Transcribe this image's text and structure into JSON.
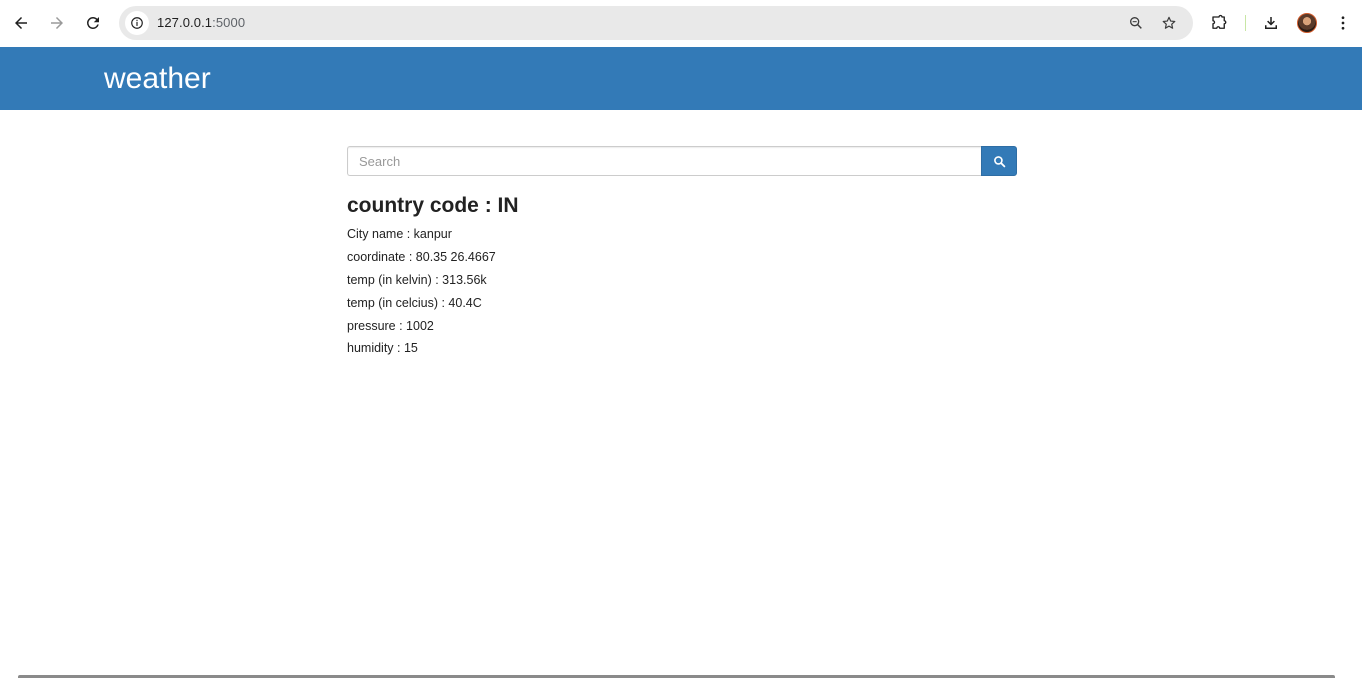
{
  "browser": {
    "url_host": "127.0.0.1",
    "url_port": ":5000",
    "icons": {
      "back": "back-arrow-icon",
      "forward": "forward-arrow-icon",
      "reload": "reload-icon",
      "site_info": "info-icon",
      "zoom": "zoom-icon",
      "bookmark": "star-icon",
      "extensions": "puzzle-icon",
      "downloads": "download-icon",
      "menu": "kebab-menu-icon"
    }
  },
  "navbar": {
    "brand": "weather",
    "background": "#337ab7"
  },
  "search": {
    "placeholder": "Search",
    "value": "",
    "button_icon": "search-icon",
    "button_color": "#337ab7"
  },
  "result": {
    "heading": "country code : IN",
    "city": "City name : kanpur",
    "coordinate": "coordinate : 80.35 26.4667",
    "temp_kelvin": "temp (in kelvin) : 313.56k",
    "temp_celsius": "temp (in celcius) : 40.4C",
    "pressure": "pressure : 1002",
    "humidity": "humidity : 15"
  }
}
